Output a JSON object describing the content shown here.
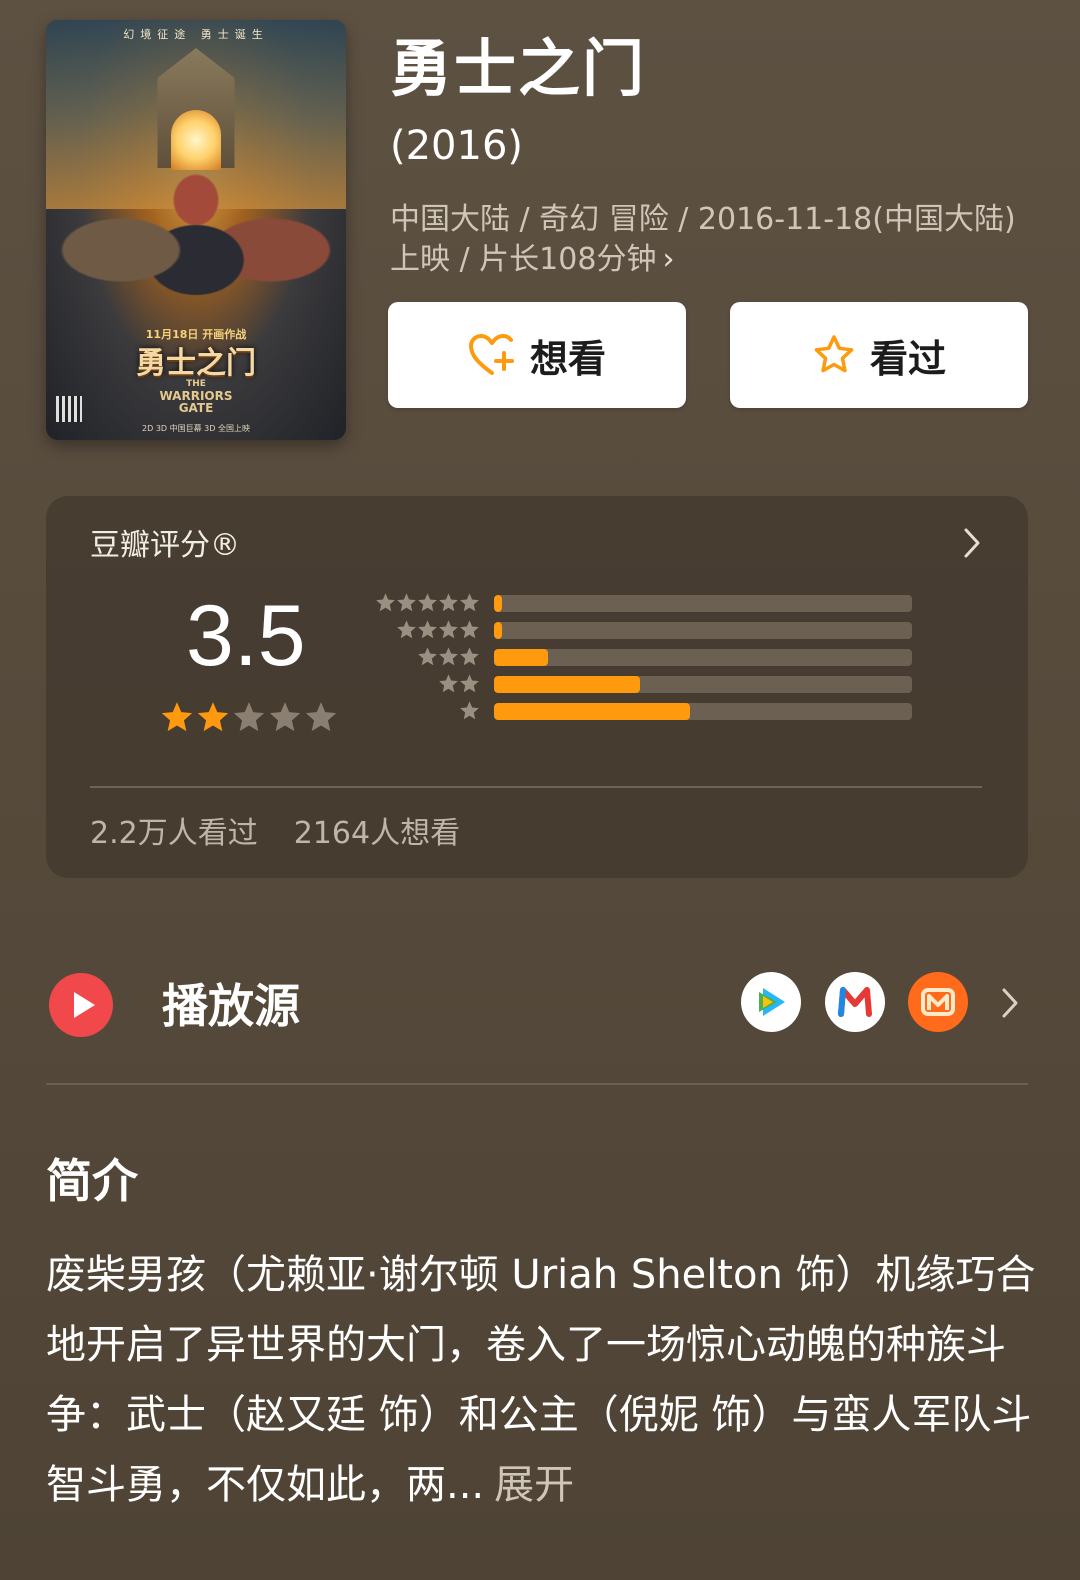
{
  "movie": {
    "title": "勇士之门",
    "year": "(2016)",
    "meta": "中国大陆 / 奇幻 冒险 / 2016-11-18(中国大陆)上映 / 片长108分钟",
    "meta_chevron": "›"
  },
  "poster": {
    "top_text": "幻境征途 勇士诞生",
    "date_text": "11月18日 开画作战",
    "title_text": "勇士之门",
    "subtitle_line1": "THE",
    "subtitle_line2": "WARRIORS",
    "subtitle_line3": "GATE",
    "bottom_text": "2D 3D 中国巨幕 3D 全国上映"
  },
  "actions": {
    "want_label": "想看",
    "seen_label": "看过",
    "want_icon": "heart-plus-icon",
    "seen_icon": "star-outline-icon",
    "accent": "#ff9a0f"
  },
  "rating": {
    "heading": "豆瓣评分®",
    "score": "3.5",
    "stars_filled": 2,
    "stars_total": 5,
    "distribution": [
      {
        "stars": 5,
        "fraction": 0.02
      },
      {
        "stars": 4,
        "fraction": 0.02
      },
      {
        "stars": 3,
        "fraction": 0.13
      },
      {
        "stars": 2,
        "fraction": 0.35
      },
      {
        "stars": 1,
        "fraction": 0.47
      }
    ],
    "watched": "2.2万人看过",
    "wanted": "2164人想看",
    "bar_color": "#ff9a0f"
  },
  "play": {
    "heading": "播放源",
    "sources": [
      "tencent-video-icon",
      "mango-icon",
      "mgtv-icon"
    ]
  },
  "synopsis": {
    "heading": "简介",
    "text": "废柴男孩（尤赖亚·谢尔顿 Uriah Shelton 饰）机缘巧合地开启了异世界的大门，卷入了一场惊心动魄的种族斗争：武士（赵又廷 饰）和公主（倪妮 饰）与蛮人军队斗智斗勇，不仅如此，两...",
    "more": "展开"
  }
}
